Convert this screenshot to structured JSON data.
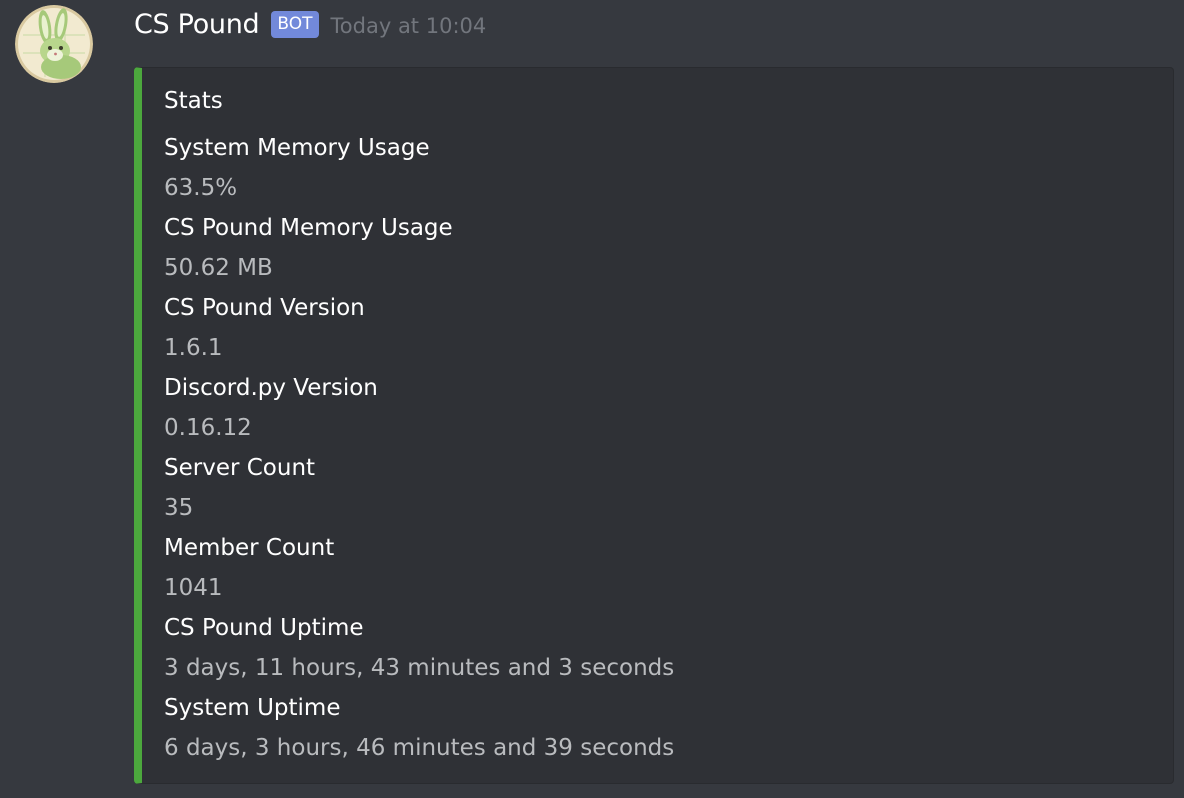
{
  "message": {
    "author": "CS Pound",
    "tag": "BOT",
    "timestamp": "Today at 10:04",
    "avatar_icon": "green-rabbit-avatar",
    "colors": {
      "background": "#36393f",
      "embed_background": "#2f3136",
      "embed_accent": "#4ca83d",
      "bot_tag": "#7289da"
    }
  },
  "embed": {
    "title": "Stats",
    "fields": [
      {
        "name": "System Memory Usage",
        "value": "63.5%"
      },
      {
        "name": "CS Pound Memory Usage",
        "value": "50.62 MB"
      },
      {
        "name": "CS Pound Version",
        "value": "1.6.1"
      },
      {
        "name": "Discord.py Version",
        "value": "0.16.12"
      },
      {
        "name": "Server Count",
        "value": "35"
      },
      {
        "name": "Member Count",
        "value": "1041"
      },
      {
        "name": "CS Pound Uptime",
        "value": "3 days, 11 hours, 43 minutes and 3 seconds"
      },
      {
        "name": "System Uptime",
        "value": "6 days, 3 hours, 46 minutes and 39 seconds"
      }
    ]
  }
}
